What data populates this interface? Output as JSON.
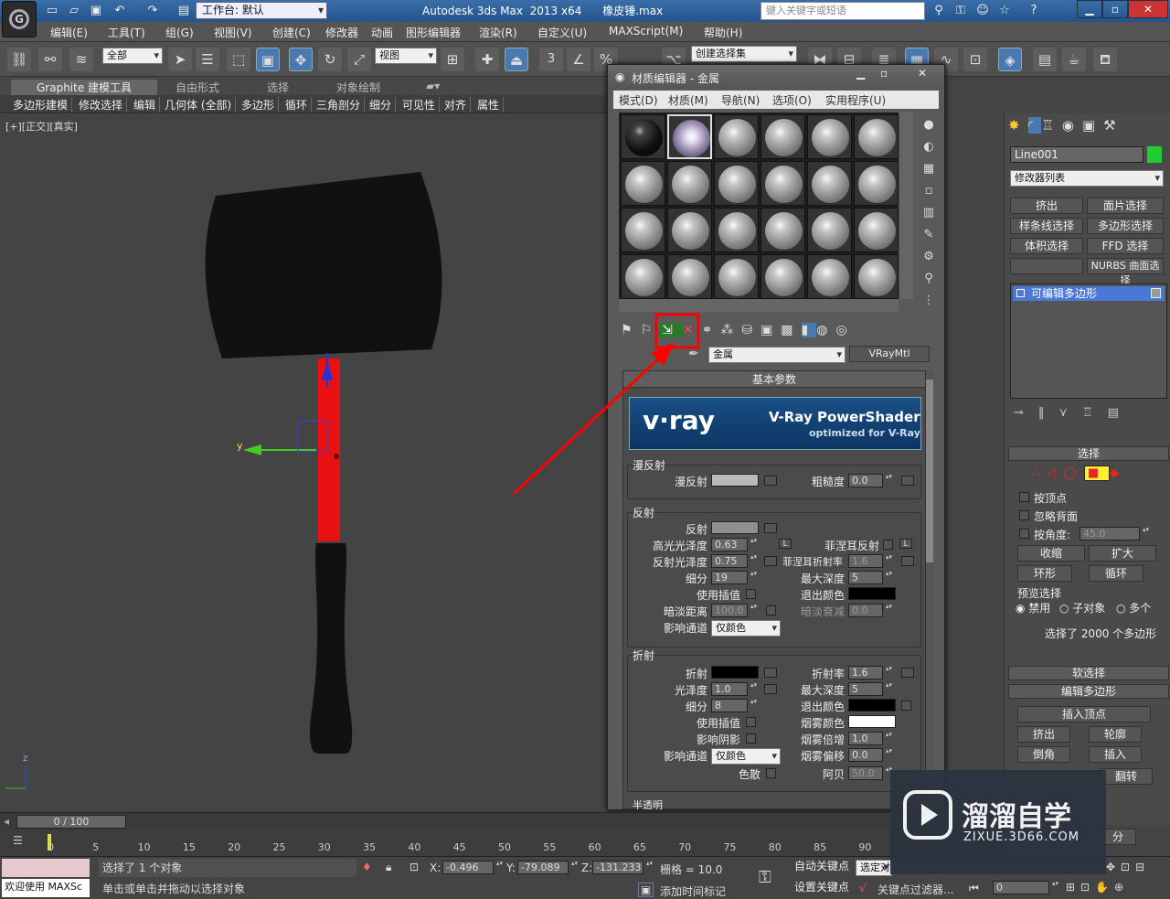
{
  "app": {
    "title": "Autodesk 3ds Max  2013 x64      橡皮锤.max",
    "workspace": "工作台: 默认",
    "search_placeholder": "键入关键字或短语"
  },
  "menu": [
    "编辑(E)",
    "工具(T)",
    "组(G)",
    "视图(V)",
    "创建(C)",
    "修改器",
    "动画",
    "图形编辑器",
    "渲染(R)",
    "自定义(U)",
    "MAXScript(M)",
    "帮助(H)"
  ],
  "toolbar": {
    "filter": "全部",
    "refcoord": "视图",
    "selset": "创建选择集",
    "snap": "3",
    "percent": "%"
  },
  "ribbon_tabs": [
    "Graphite 建模工具",
    "自由形式",
    "选择",
    "对象绘制"
  ],
  "ribbon_items": [
    "多边形建模",
    "修改选择",
    "编辑",
    "几何体 (全部)",
    "多边形",
    "循环",
    "三角剖分",
    "细分",
    "可见性",
    "对齐",
    "属性"
  ],
  "viewport": {
    "label": "[+][正交][真实]",
    "axis_y": "y",
    "axis_z": "z"
  },
  "mat": {
    "title": "材质编辑器 - 金属",
    "menu": [
      "模式(D)",
      "材质(M)",
      "导航(N)",
      "选项(O)",
      "实用程序(U)"
    ],
    "name": "金属",
    "type": "VRayMtl",
    "rollout": "基本参数",
    "vray_brand": "v·ray",
    "vray_title": "V-Ray PowerShader",
    "vray_sub": "optimized for V-Ray",
    "diffuse": {
      "group": "漫反射",
      "diffuse": "漫反射",
      "rough": "粗糙度",
      "rough_val": "0.0"
    },
    "reflect": {
      "group": "反射",
      "reflect": "反射",
      "hilight": "高光光泽度",
      "hilight_val": "0.63",
      "fresnel": "菲涅耳反射",
      "gloss": "反射光泽度",
      "gloss_val": "0.75",
      "fior": "菲涅耳折射率",
      "fior_val": "1.6",
      "subdiv": "细分",
      "subdiv_val": "19",
      "maxdepth": "最大深度",
      "maxdepth_val": "5",
      "interp": "使用插值",
      "exitcol": "退出颜色",
      "dimdist": "暗淡距离",
      "dimdist_val": "100.0",
      "dimfall": "暗淡衰减",
      "dimfall_val": "0.0",
      "affect": "影响通道",
      "affect_val": "仅颜色",
      "L": "L"
    },
    "refract": {
      "group": "折射",
      "refract": "折射",
      "ior": "折射率",
      "ior_val": "1.6",
      "gloss": "光泽度",
      "gloss_val": "1.0",
      "maxdepth": "最大深度",
      "maxdepth_val": "5",
      "subdiv": "细分",
      "subdiv_val": "8",
      "exitcol": "退出颜色",
      "interp": "使用插值",
      "fogcol": "烟雾颜色",
      "shadows": "影响阴影",
      "fogmult": "烟雾倍增",
      "fogmult_val": "1.0",
      "affect": "影响通道",
      "affect_val": "仅颜色",
      "fogbias": "烟雾偏移",
      "fogbias_val": "0.0",
      "disp": "色散",
      "abbe": "阿贝",
      "abbe_val": "50.0"
    },
    "translucent": "半透明"
  },
  "right": {
    "objname": "Line001",
    "modlist": "修改器列表",
    "btns": [
      "挤出",
      "面片选择",
      "样条线选择",
      "多边形选择",
      "体积选择",
      "FFD 选择",
      "",
      "NURBS 曲面选择"
    ],
    "stack": "可编辑多边形",
    "sel": {
      "title": "选择",
      "byvertex": "按顶点",
      "ignore": "忽略背面",
      "byangle": "按角度:",
      "angle": "45.0",
      "shrink": "收缩",
      "grow": "扩大",
      "ring": "环形",
      "loop": "循环",
      "preview": "预览选择",
      "off": "禁用",
      "sub": "子对象",
      "multi": "多个",
      "count": "选择了 2000 个多边形"
    },
    "soft": "软选择",
    "editpoly": "编辑多边形",
    "insvert": "插入顶点",
    "extrude": "挤出",
    "outline": "轮廓",
    "bevel": "倒角",
    "inset": "插入",
    "flip": "翻转",
    "split": "分"
  },
  "timeline": {
    "frame": "0 / 100",
    "ticks": [
      "0",
      "5",
      "10",
      "15",
      "20",
      "25",
      "30",
      "35",
      "40",
      "45",
      "50",
      "55",
      "60",
      "65",
      "70",
      "75",
      "80",
      "85",
      "90"
    ]
  },
  "status": {
    "welcome": "欢迎使用 MAXSc",
    "selected": "选择了 1 个对象",
    "hint": "单击或单击并拖动以选择对象",
    "x_label": "X:",
    "x": "-0.496",
    "y_label": "Y:",
    "y": "-79.089",
    "z_label": "Z:",
    "z": "-131.233",
    "grid": "栅格 = 10.0",
    "addtime": "添加时间标记",
    "autokey": "自动关键点",
    "setkey": "设置关键点",
    "selected_obj": "选定对",
    "keyfilter": "关键点过滤器...",
    "frame_val": "0"
  },
  "watermark": {
    "brand": "溜溜自学",
    "url": "ZIXUE.3D66.COM"
  },
  "colors": {
    "accent": "#ff0000",
    "handle": "#e81010",
    "hammer": "#111111"
  }
}
